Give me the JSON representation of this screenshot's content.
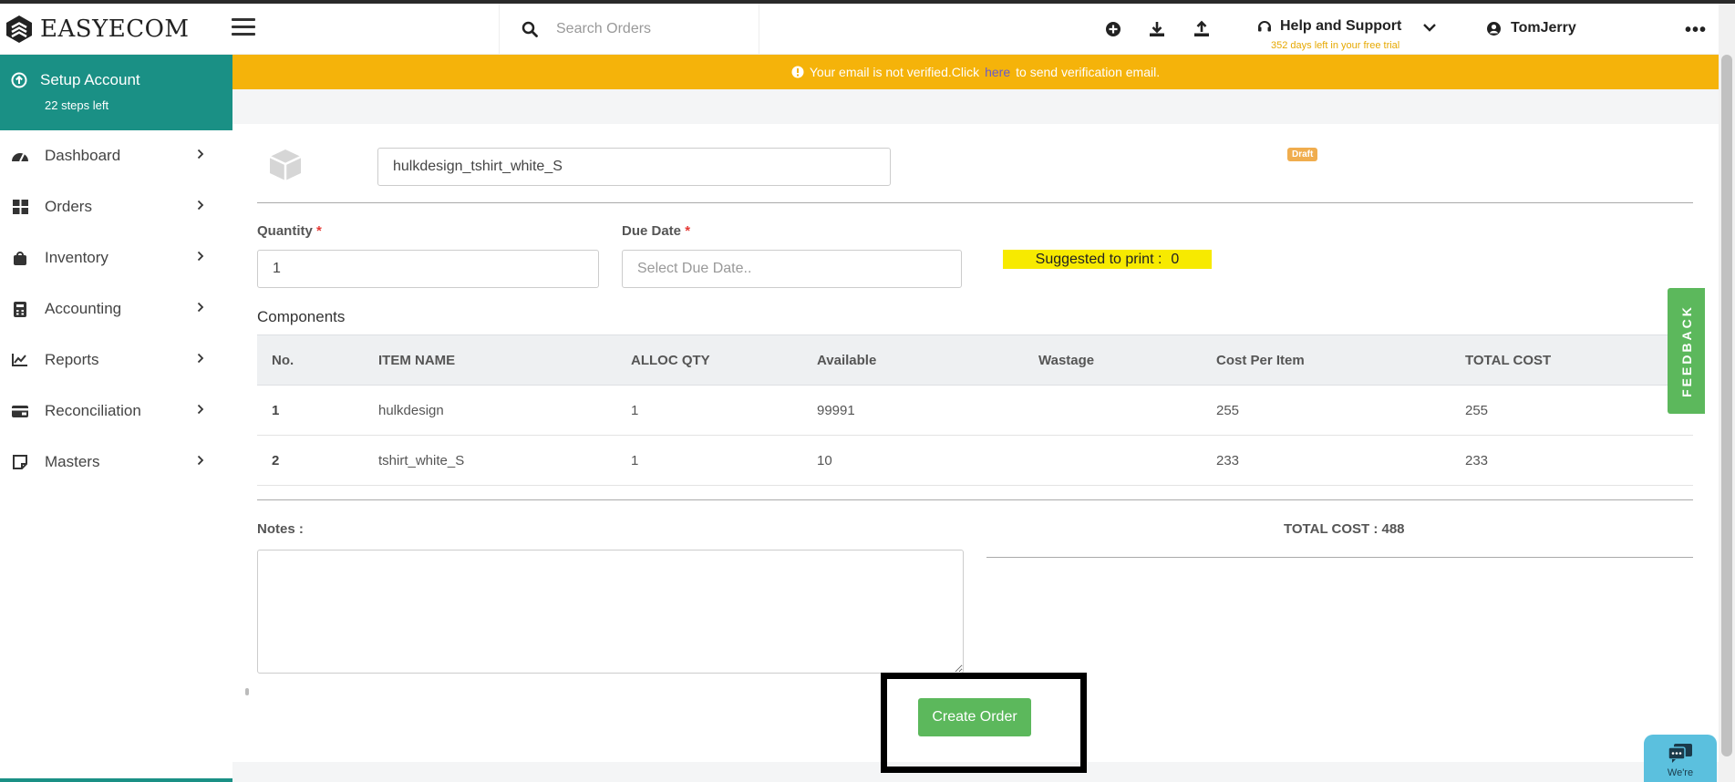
{
  "header": {
    "logo_text": "EASYECOM",
    "search_placeholder": "Search Orders",
    "help_label": "Help and Support",
    "trial_text": "352 days left in your free trial",
    "user_name": "TomJerry",
    "more_label": "•••"
  },
  "sidebar": {
    "setup_title": "Setup Account",
    "setup_sub": "22 steps left",
    "items": [
      {
        "label": "Dashboard",
        "icon": "dashboard-icon"
      },
      {
        "label": "Orders",
        "icon": "orders-icon"
      },
      {
        "label": "Inventory",
        "icon": "inventory-icon"
      },
      {
        "label": "Accounting",
        "icon": "accounting-icon"
      },
      {
        "label": "Reports",
        "icon": "reports-icon"
      },
      {
        "label": "Reconciliation",
        "icon": "reconciliation-icon"
      },
      {
        "label": "Masters",
        "icon": "masters-icon"
      }
    ]
  },
  "banner": {
    "text_before": "Your email is not verified.Click",
    "link": "here",
    "text_after": "to send verification email."
  },
  "form": {
    "product_value": "hulkdesign_tshirt_white_S",
    "draft_label": "Draft",
    "quantity_label": "Quantity",
    "quantity_value": "1",
    "due_date_label": "Due Date",
    "due_date_placeholder": "Select Due Date..",
    "required_mark": "*",
    "suggest_label": "Suggested to print :",
    "suggest_value": "0"
  },
  "components": {
    "title": "Components",
    "columns": [
      "No.",
      "ITEM NAME",
      "ALLOC QTY",
      "Available",
      "Wastage",
      "Cost Per Item",
      "TOTAL COST"
    ],
    "rows": [
      [
        "1",
        "hulkdesign",
        "1",
        "99991",
        "",
        "255",
        "255"
      ],
      [
        "2",
        "tshirt_white_S",
        "1",
        "10",
        "",
        "233",
        "233"
      ]
    ]
  },
  "notes_label": "Notes :",
  "total_cost": "TOTAL COST : 488",
  "create_button": "Create Order",
  "feedback_label": "FEEDBACK",
  "chat_label": "We're",
  "colors": {
    "accent": "#1a9085",
    "banner": "#f5b30a",
    "success": "#5cb85c",
    "highlight": "#f7ea00"
  }
}
